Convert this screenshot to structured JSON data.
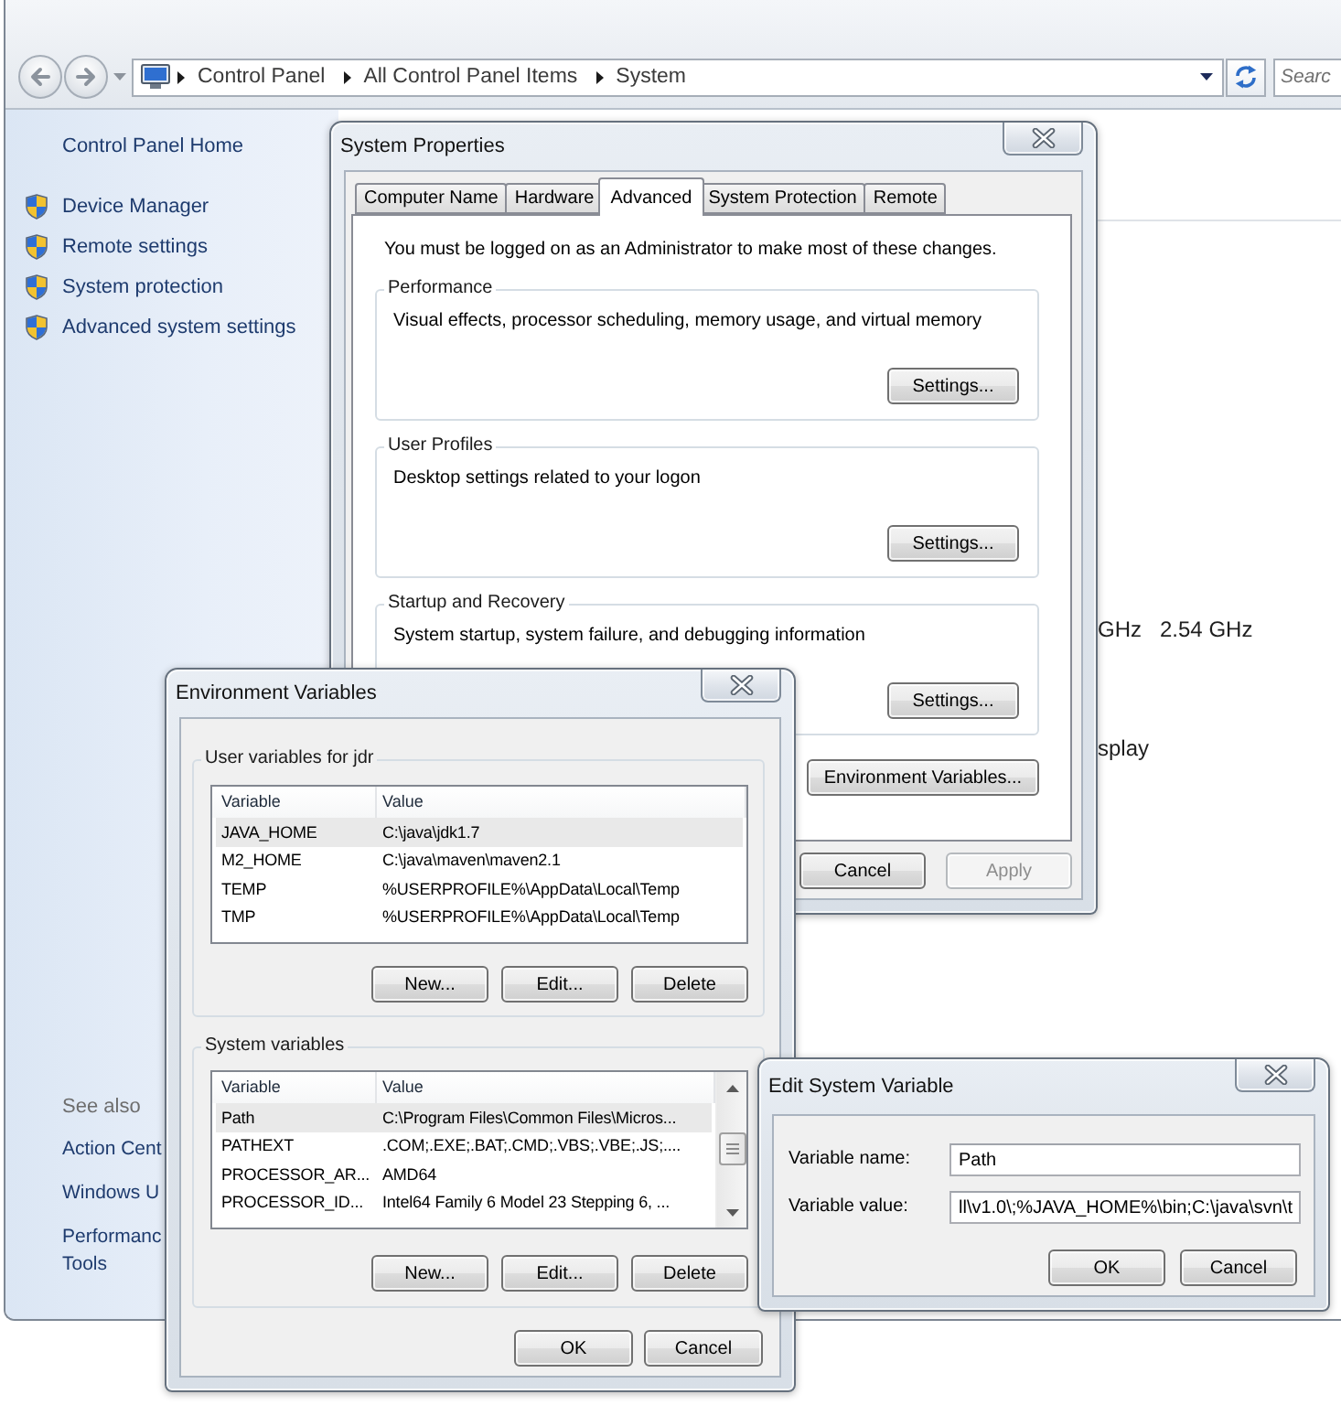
{
  "explorer": {
    "address_bar": {
      "breadcrumbs": [
        "Control Panel",
        "All Control Panel Items",
        "System"
      ]
    },
    "search": {
      "placeholder": "Searc"
    },
    "sidebar": {
      "home_link": "Control Panel Home",
      "tasks": [
        "Device Manager",
        "Remote settings",
        "System protection",
        "Advanced system settings"
      ],
      "see_also": {
        "heading": "See also",
        "links": [
          "Action Cent",
          "Windows U",
          "Performanc\nTools"
        ]
      }
    },
    "content": {
      "lines": [
        "GHz   2.54 GHz",
        "splay"
      ]
    }
  },
  "system_properties": {
    "title": "System Properties",
    "tabs": [
      {
        "label": "Computer Name",
        "selected": false
      },
      {
        "label": "Hardware",
        "selected": false
      },
      {
        "label": "Advanced",
        "selected": true
      },
      {
        "label": "System Protection",
        "selected": false
      },
      {
        "label": "Remote",
        "selected": false
      }
    ],
    "notice": "You must be logged on as an Administrator to make most of these changes.",
    "groups": [
      {
        "title": "Performance",
        "description": "Visual effects, processor scheduling, memory usage, and virtual memory",
        "button": "Settings..."
      },
      {
        "title": "User Profiles",
        "description": "Desktop settings related to your logon",
        "button": "Settings..."
      },
      {
        "title": "Startup and Recovery",
        "description": "System startup, system failure, and debugging information",
        "button": "Settings..."
      }
    ],
    "environment_button": "Environment Variables...",
    "buttons": [
      {
        "label": "Cancel",
        "disabled": false
      },
      {
        "label": "Apply",
        "disabled": true
      }
    ]
  },
  "environment_variables": {
    "title": "Environment Variables",
    "sections": [
      {
        "title": "User variables for jdr",
        "columns": [
          "Variable",
          "Value"
        ],
        "scrollbar": false,
        "rows": [
          {
            "variable": "JAVA_HOME",
            "value": "C:\\java\\jdk1.7",
            "selected": true
          },
          {
            "variable": "M2_HOME",
            "value": "C:\\java\\maven\\maven2.1",
            "selected": false
          },
          {
            "variable": "TEMP",
            "value": "%USERPROFILE%\\AppData\\Local\\Temp",
            "selected": false
          },
          {
            "variable": "TMP",
            "value": "%USERPROFILE%\\AppData\\Local\\Temp",
            "selected": false
          }
        ],
        "buttons": [
          "New...",
          "Edit...",
          "Delete"
        ]
      },
      {
        "title": "System variables",
        "columns": [
          "Variable",
          "Value"
        ],
        "scrollbar": true,
        "rows": [
          {
            "variable": "Path",
            "value": "C:\\Program Files\\Common Files\\Micros...",
            "selected": true
          },
          {
            "variable": "PATHEXT",
            "value": ".COM;.EXE;.BAT;.CMD;.VBS;.VBE;.JS;....",
            "selected": false
          },
          {
            "variable": "PROCESSOR_AR...",
            "value": "AMD64",
            "selected": false
          },
          {
            "variable": "PROCESSOR_ID...",
            "value": "Intel64 Family 6 Model 23 Stepping 6, ...",
            "selected": false
          }
        ],
        "buttons": [
          "New...",
          "Edit...",
          "Delete"
        ]
      }
    ],
    "buttons": [
      "OK",
      "Cancel"
    ]
  },
  "edit_system_variable": {
    "title": "Edit System Variable",
    "fields": [
      {
        "label": "Variable name:",
        "value": "Path"
      },
      {
        "label": "Variable value:",
        "value": "ll\\v1.0\\;%JAVA_HOME%\\bin;C:\\java\\svn\\t"
      }
    ],
    "buttons": [
      "OK",
      "Cancel"
    ]
  }
}
